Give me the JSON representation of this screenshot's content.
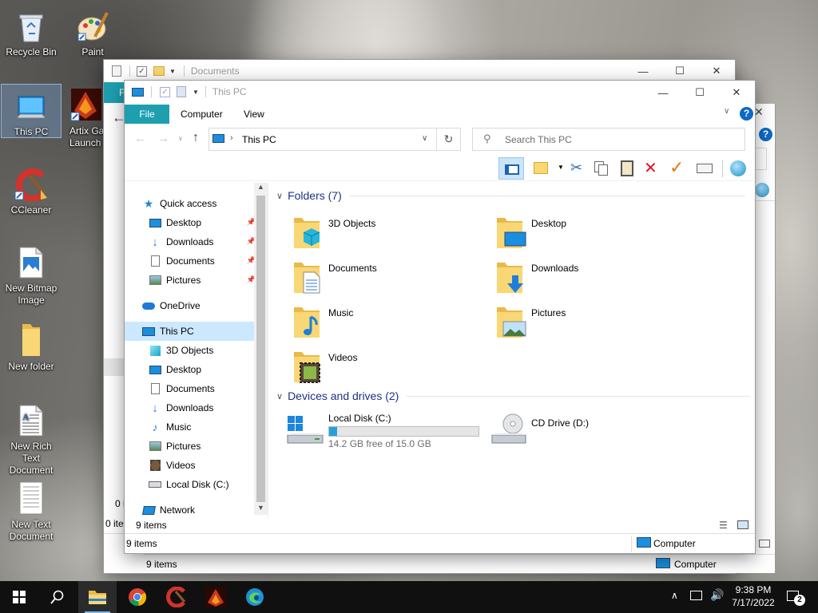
{
  "desktop": {
    "icons": [
      {
        "label": "Recycle Bin",
        "icon": "recycle-bin-icon"
      },
      {
        "label": "Paint",
        "icon": "paint-icon"
      },
      {
        "label": "This PC",
        "icon": "this-pc-icon"
      },
      {
        "label": "Artix Ga Launch",
        "icon": "artix-launcher-icon"
      },
      {
        "label": "CCleaner",
        "icon": "ccleaner-icon"
      },
      {
        "label": "New Bitmap Image",
        "icon": "bitmap-file-icon"
      },
      {
        "label": "New folder",
        "icon": "folder-icon"
      },
      {
        "label": "New Rich Text Document",
        "icon": "rtf-file-icon"
      },
      {
        "label": "New Text Document",
        "icon": "text-file-icon"
      }
    ]
  },
  "back_window": {
    "title": "Documents",
    "status_count": "9 items",
    "status_computer": "Computer",
    "left_fragments": [
      "0 i",
      "0 ite"
    ]
  },
  "window": {
    "title": "This PC",
    "ribbon_tabs": [
      "File",
      "Computer",
      "View"
    ],
    "address": "This PC",
    "search_placeholder": "Search This PC",
    "help": "?",
    "nav": {
      "quick_access": "Quick access",
      "quick_items": [
        "Desktop",
        "Downloads",
        "Documents",
        "Pictures"
      ],
      "onedrive": "OneDrive",
      "this_pc": "This PC",
      "pc_items": [
        "3D Objects",
        "Desktop",
        "Documents",
        "Downloads",
        "Music",
        "Pictures",
        "Videos",
        "Local Disk (C:)"
      ],
      "network": "Network"
    },
    "folders_header": "Folders (7)",
    "folders": [
      "3D Objects",
      "Desktop",
      "Documents",
      "Downloads",
      "Music",
      "Pictures",
      "Videos"
    ],
    "drives_header": "Devices and drives (2)",
    "drives": [
      {
        "name": "Local Disk (C:)",
        "free": "14.2 GB free of 15.0 GB",
        "used_fraction": 0.053
      },
      {
        "name": "CD Drive (D:)"
      }
    ],
    "status_count": "9 items"
  },
  "outer_status": {
    "count": "9 items",
    "computer": "Computer"
  },
  "taskbar": {
    "time": "9:38 PM",
    "date": "7/17/2022",
    "notification_count": "2"
  },
  "colors": {
    "accent": "#0078d7",
    "file_tab": "#1e9fb0",
    "drive_bar": "#26a0da",
    "delete_red": "#e81123"
  }
}
